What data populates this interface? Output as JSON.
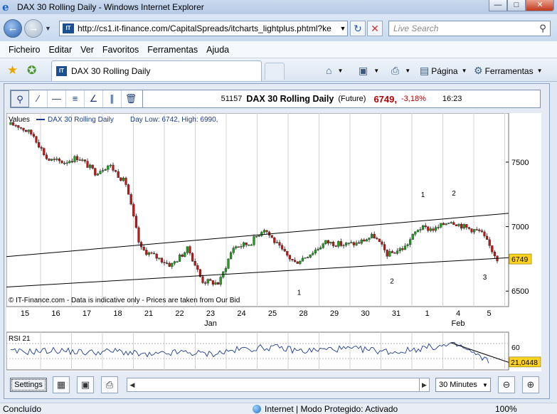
{
  "window": {
    "title": "DAX 30 Rolling Daily - Windows Internet Explorer"
  },
  "address_bar": {
    "url": "http://cs1.it-finance.com/CapitalSpreads/itcharts_lightplus.phtml?ke",
    "search_placeholder": "Live Search"
  },
  "menu": [
    "Ficheiro",
    "Editar",
    "Ver",
    "Favoritos",
    "Ferramentas",
    "Ajuda"
  ],
  "tab": {
    "title": "DAX 30 Rolling Daily",
    "site_icon": "IT"
  },
  "commands": {
    "page": "Página",
    "tools": "Ferramentas"
  },
  "quote": {
    "code": "51157",
    "name": "DAX 30 Rolling Daily",
    "type": "(Future)",
    "price": "6749,",
    "change": "-3,18%",
    "time": "16:23"
  },
  "chart_legend": {
    "values_label": "Values",
    "series_name": "DAX 30  Rolling Daily",
    "day_range": "Day Low: 6742, High: 6990,"
  },
  "disclaimer": "© IT-Finance.com - Data is indicative only - Prices are taken from Our Bid",
  "icons": {
    "back": "back-arrow-icon",
    "forward": "forward-arrow-icon",
    "refresh": "refresh-icon",
    "stop": "stop-icon",
    "search": "search-icon",
    "favorites": "star-icon",
    "add_favorite": "add-favorite-icon",
    "home": "home-icon",
    "feeds": "rss-icon",
    "print": "printer-icon",
    "page": "page-icon",
    "tools": "gear-icon",
    "zoom_tool": "zoom-tool-icon",
    "line_tool": "trend-line-icon",
    "hline_tool": "horizontal-line-icon",
    "fib_tool": "fibonacci-icon",
    "channel_tool": "channel-icon",
    "parallel_tool": "parallel-lines-icon",
    "delete": "trash-icon",
    "calculator": "calculator-icon",
    "save": "save-icon",
    "zoom_out": "zoom-out-icon",
    "zoom_in": "zoom-in-icon"
  },
  "colors": {
    "candle_up": "#1aa31a",
    "candle_down": "#c81414",
    "price_tag": "#ffd21f",
    "price_line": "#000000",
    "rsi_line": "#1d3c8c"
  },
  "rsi": {
    "label": "RSI 21",
    "value": "21,0448"
  },
  "controls": {
    "settings_label": "Settings",
    "interval_value": "30 Minutes"
  },
  "status": {
    "left": "Concluído",
    "zone": "Internet | Modo Protegido: Activado",
    "zoom": "100%"
  },
  "chart_data": {
    "type": "candlestick",
    "title": "DAX 30 Rolling Daily",
    "x_tick_labels": [
      "15",
      "16",
      "17",
      "18",
      "21",
      "22",
      "23",
      "24",
      "25",
      "28",
      "29",
      "30",
      "31",
      "1",
      "4",
      "5"
    ],
    "x_month_labels": [
      {
        "label": "Jan",
        "at": "23"
      },
      {
        "label": "Feb",
        "at": "4"
      }
    ],
    "y_tick_labels": [
      "7500",
      "7000",
      "6500"
    ],
    "ylim": [
      6380,
      7880
    ],
    "current_price": 6749,
    "price_path": [
      {
        "x": "15",
        "y": 7790
      },
      {
        "x": "15",
        "y": 7710
      },
      {
        "x": "16",
        "y": 7520
      },
      {
        "x": "16",
        "y": 7500
      },
      {
        "x": "17",
        "y": 7540
      },
      {
        "x": "17",
        "y": 7420
      },
      {
        "x": "18",
        "y": 7480
      },
      {
        "x": "18",
        "y": 7330
      },
      {
        "x": "21",
        "y": 6830
      },
      {
        "x": "21",
        "y": 6760
      },
      {
        "x": "22",
        "y": 6700
      },
      {
        "x": "22",
        "y": 6830
      },
      {
        "x": "23",
        "y": 6580
      },
      {
        "x": "23",
        "y": 6560
      },
      {
        "x": "24",
        "y": 6840
      },
      {
        "x": "24",
        "y": 6870
      },
      {
        "x": "25",
        "y": 6990
      },
      {
        "x": "25",
        "y": 6820
      },
      {
        "x": "28",
        "y": 6720
      },
      {
        "x": "28",
        "y": 6800
      },
      {
        "x": "29",
        "y": 6880
      },
      {
        "x": "29",
        "y": 6860
      },
      {
        "x": "30",
        "y": 6870
      },
      {
        "x": "30",
        "y": 6930
      },
      {
        "x": "31",
        "y": 6780
      },
      {
        "x": "31",
        "y": 6840
      },
      {
        "x": "1",
        "y": 6990
      },
      {
        "x": "1",
        "y": 6980
      },
      {
        "x": "4",
        "y": 7050
      },
      {
        "x": "4",
        "y": 6990
      },
      {
        "x": "5",
        "y": 6960
      },
      {
        "x": "5",
        "y": 6749
      }
    ],
    "trendlines": [
      {
        "name": "upper-channel",
        "from": {
          "x": "15",
          "y": 6780
        },
        "to": {
          "x": "5",
          "y": 7090
        }
      },
      {
        "name": "lower-channel",
        "from": {
          "x": "15",
          "y": 6540
        },
        "to": {
          "x": "5",
          "y": 6750
        }
      }
    ],
    "annotations": [
      {
        "text": "1",
        "x": "28",
        "y": 6470
      },
      {
        "text": "2",
        "x": "31",
        "y": 6560
      },
      {
        "text": "1",
        "x": "1",
        "y": 7230
      },
      {
        "text": "2",
        "x": "4",
        "y": 7240
      },
      {
        "text": "3",
        "x": "5",
        "y": 6590
      }
    ],
    "rsi": {
      "label": "RSI 21",
      "ylim": [
        0,
        100
      ],
      "y_tick_labels": [
        "60"
      ],
      "current": 21.0448,
      "path": [
        {
          "x": "15",
          "y": 48
        },
        {
          "x": "16",
          "y": 52
        },
        {
          "x": "17",
          "y": 46
        },
        {
          "x": "18",
          "y": 50
        },
        {
          "x": "21",
          "y": 38
        },
        {
          "x": "22",
          "y": 47
        },
        {
          "x": "23",
          "y": 42
        },
        {
          "x": "24",
          "y": 55
        },
        {
          "x": "25",
          "y": 60
        },
        {
          "x": "28",
          "y": 50
        },
        {
          "x": "29",
          "y": 56
        },
        {
          "x": "30",
          "y": 54
        },
        {
          "x": "31",
          "y": 47
        },
        {
          "x": "1",
          "y": 60
        },
        {
          "x": "4",
          "y": 66
        },
        {
          "x": "5",
          "y": 21
        }
      ],
      "trendline": {
        "from": {
          "x": "4",
          "y": 72
        },
        "to": {
          "x": "5",
          "y": 20
        }
      }
    }
  }
}
